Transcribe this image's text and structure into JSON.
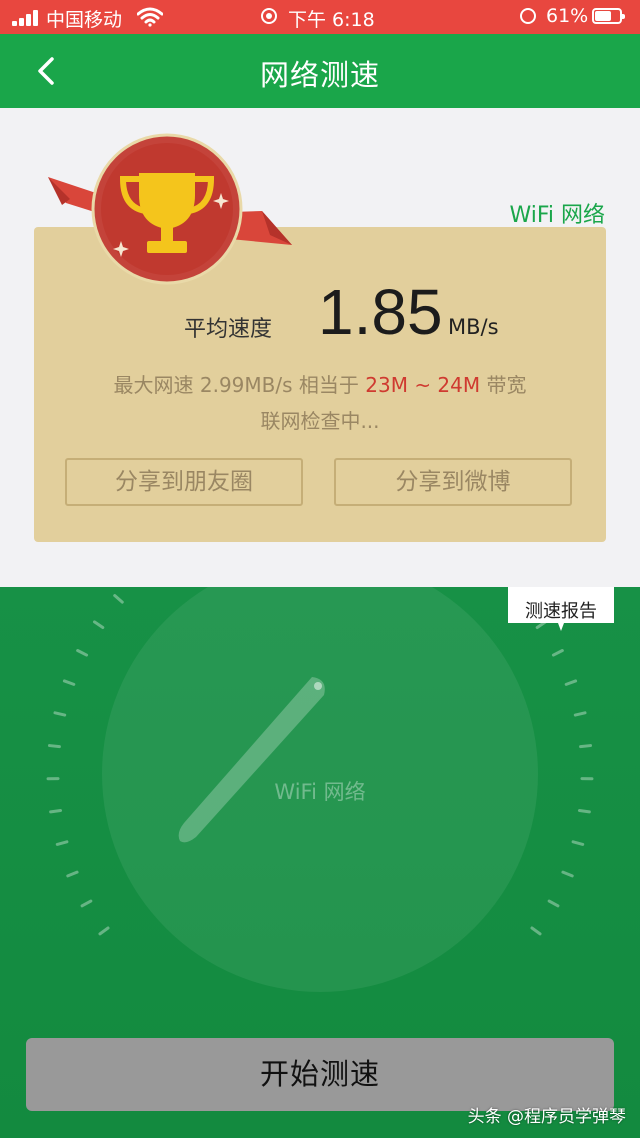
{
  "status_bar": {
    "carrier": "中国移动",
    "time": "下午 6:18",
    "battery": "61%"
  },
  "nav": {
    "title": "网络测速",
    "back_icon": "chevron-left-icon"
  },
  "result": {
    "network_type": "WiFi 网络",
    "avg_label": "平均速度",
    "speed_value": "1.85",
    "speed_unit": "MB/s",
    "max_prefix": "最大网速 2.99MB/s 相当于",
    "bandwidth": "23M ~ 24M",
    "bandwidth_suffix": "带宽",
    "checking": "联网检查中...",
    "share_moments": "分享到朋友圈",
    "share_weibo": "分享到微博"
  },
  "gauge": {
    "network_type": "WiFi 网络",
    "report_tag": "测速报告"
  },
  "start_button": "开始测速",
  "watermark": "头条 @程序员学弹琴",
  "colors": {
    "status_bar": "#e8473f",
    "nav": "#1aa64a",
    "card": "#e2cf9c",
    "highlight": "#cf3a30",
    "gauge_bg": "#179146",
    "start_button": "#999999"
  }
}
